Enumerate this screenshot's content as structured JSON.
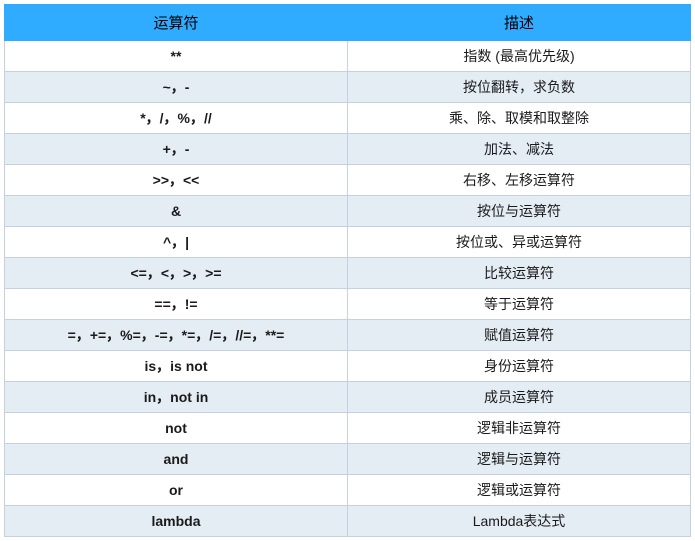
{
  "table": {
    "headers": {
      "col1": "运算符",
      "col2": "描述"
    },
    "rows": [
      {
        "operator": "**",
        "description": "指数 (最高优先级)"
      },
      {
        "operator": "~，-",
        "description": "按位翻转，求负数"
      },
      {
        "operator": "*，/，%，//",
        "description": "乘、除、取模和取整除"
      },
      {
        "operator": "+，-",
        "description": "加法、减法"
      },
      {
        "operator": ">>，<<",
        "description": "右移、左移运算符"
      },
      {
        "operator": "&",
        "description": "按位与运算符"
      },
      {
        "operator": "^，|",
        "description": "按位或、异或运算符"
      },
      {
        "operator": "<=，<，>，>=",
        "description": "比较运算符"
      },
      {
        "operator": "==，!=",
        "description": "等于运算符"
      },
      {
        "operator": "=，+=，%=，-=，*=，/=，//=，**=",
        "description": "赋值运算符"
      },
      {
        "operator": "is，is not",
        "description": "身份运算符"
      },
      {
        "operator": "in，not in",
        "description": "成员运算符"
      },
      {
        "operator": "not",
        "description": "逻辑非运算符"
      },
      {
        "operator": "and",
        "description": "逻辑与运算符"
      },
      {
        "operator": "or",
        "description": "逻辑或运算符"
      },
      {
        "operator": "lambda",
        "description": "Lambda表达式"
      }
    ]
  }
}
